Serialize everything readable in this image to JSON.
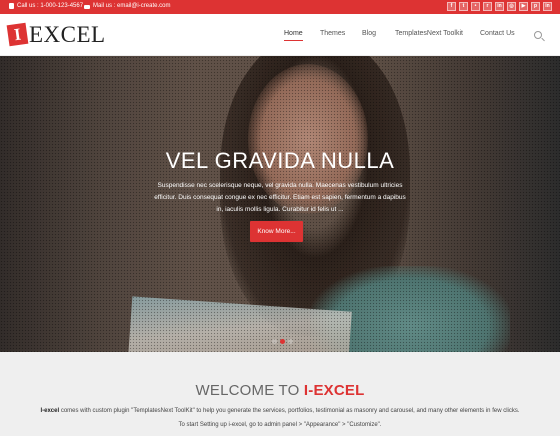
{
  "topbar": {
    "phone_text": "Call us : 1-000-123-4567",
    "email_text": "Mail us : email@i-create.com",
    "social_icons": [
      "facebook-icon",
      "twitter-icon",
      "flickr-icon",
      "rss-icon",
      "linkedin-icon",
      "instagram-icon",
      "youtube-icon",
      "pinterest-icon",
      "linkedin-in-icon"
    ]
  },
  "brand": {
    "mark": "I",
    "name": "EXCEL"
  },
  "nav": {
    "items": [
      {
        "label": "Home",
        "active": true
      },
      {
        "label": "Themes"
      },
      {
        "label": "Blog"
      },
      {
        "label": "TemplatesNext Toolkit"
      },
      {
        "label": "Contact Us"
      }
    ]
  },
  "hero": {
    "title": "VEL GRAVIDA NULLA",
    "text": "Suspendisse nec scelerisque neque, vel gravida nulla. Maecenas vestibulum ultricies efficitur. Duis consequat congue ex nec efficitur. Etiam est sapien, fermentum a dapibus in, iaculis mollis ligula. Curabitur id felis ut ...",
    "button": "Know More...",
    "slides": 3,
    "active_slide": 2
  },
  "welcome": {
    "title_prefix": "WELCOME TO ",
    "title_brand": "I-EXCEL",
    "p1_brand": "I-excel",
    "p1_text": " comes with custom plugin \"TemplatesNext ToolKit\" to help you generate the services, portfolios, testimonial as masonry and carousel, and many other elements in few clicks.",
    "p2_text": "To start Setting up i-excel, go to admin panel > \"Appearance\" > \"Customize\"."
  },
  "colors": {
    "accent": "#dd3333",
    "welcome_bg": "#efefef"
  }
}
